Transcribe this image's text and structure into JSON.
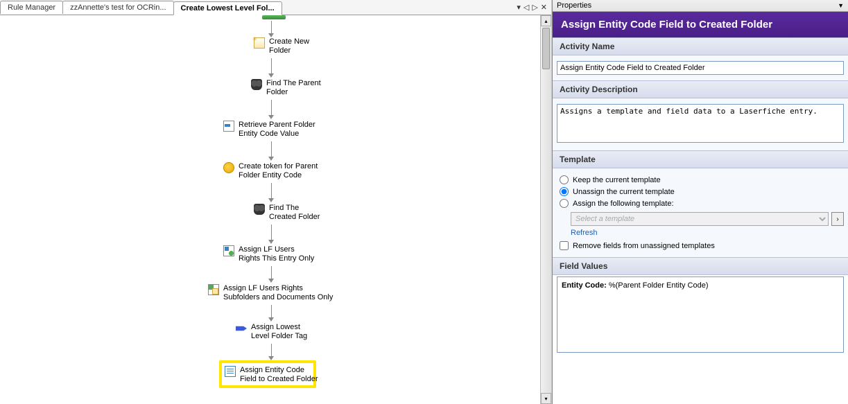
{
  "tabs": {
    "t0": "Rule Manager",
    "t1": "zzAnnette's test for OCRin...",
    "t2": "Create Lowest Level Fol..."
  },
  "tab_controls": {
    "menu": "▾",
    "prev": "◁",
    "next": "▷",
    "close": "✕"
  },
  "workflow": {
    "n0": "Create New\nFolder",
    "n1": "Find The Parent\nFolder",
    "n2": "Retrieve Parent Folder\nEntity Code Value",
    "n3": "Create token for Parent\nFolder Entity Code",
    "n4": "Find The\nCreated Folder",
    "n5": "Assign LF Users\nRights This Entry Only",
    "n6": "Assign LF Users Rights\nSubfolders and Documents Only",
    "n7": "Assign Lowest\nLevel Folder Tag",
    "n8": "Assign Entity Code\nField to Created Folder"
  },
  "props": {
    "panel_title": "Properties",
    "title": "Assign Entity Code Field to Created Folder",
    "sec_name": "Activity Name",
    "name_value": "Assign Entity Code Field to Created Folder",
    "sec_desc": "Activity Description",
    "desc_value": "Assigns a template and field data to a Laserfiche entry.",
    "sec_tpl": "Template",
    "tpl_opt0": "Keep the current template",
    "tpl_opt1": "Unassign the current template",
    "tpl_opt2": "Assign the following template:",
    "tpl_select_placeholder": "Select a template",
    "tpl_refresh": "Refresh",
    "tpl_remove": "Remove fields from unassigned templates",
    "sec_fv": "Field Values",
    "fv_label": "Entity Code:",
    "fv_value": "%(Parent Folder Entity Code)"
  }
}
